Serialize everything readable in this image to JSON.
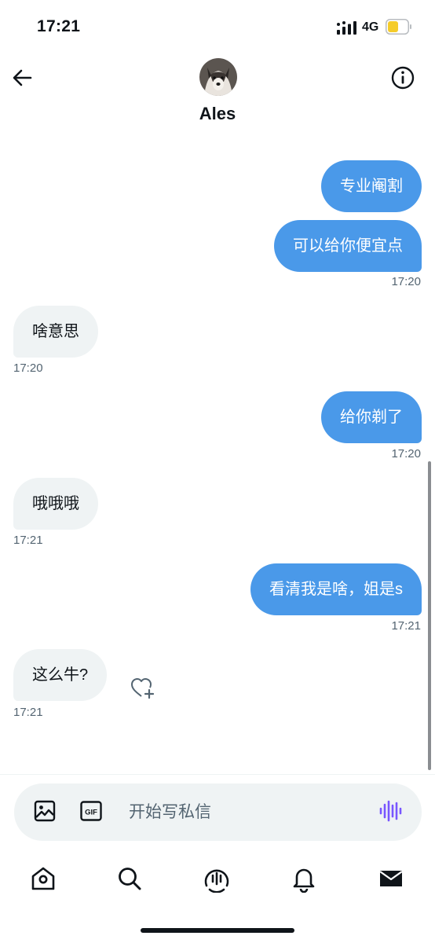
{
  "status_bar": {
    "time": "17:21",
    "network": "4G",
    "battery_color": "#f5cc2a"
  },
  "header": {
    "contact_name": "Ales",
    "back_icon": "arrow-left-icon",
    "info_icon": "info-circle-icon"
  },
  "messages": [
    {
      "side": "sent",
      "text": "专业阉割"
    },
    {
      "side": "sent",
      "text": "可以给你便宜点",
      "time": "17:20"
    },
    {
      "side": "received",
      "text": "啥意思",
      "time": "17:20"
    },
    {
      "side": "sent",
      "text": "给你剃了",
      "time": "17:20"
    },
    {
      "side": "received",
      "text": "哦哦哦",
      "time": "17:21"
    },
    {
      "side": "sent",
      "text": "看清我是啥，姐是s",
      "time": "17:21"
    },
    {
      "side": "received",
      "text": "这么牛?",
      "time": "17:21"
    }
  ],
  "composer": {
    "placeholder": "开始写私信",
    "gif_label": "GIF",
    "voice_color": "#7856ff"
  },
  "tabbar": {
    "items": [
      "home-icon",
      "search-icon",
      "spaces-icon",
      "notifications-icon",
      "messages-icon"
    ]
  },
  "colors": {
    "sent_bubble": "#4a99e9",
    "received_bubble": "#eff3f4"
  }
}
